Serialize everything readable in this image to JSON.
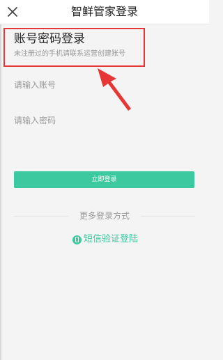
{
  "nav": {
    "title": "智鲜管家登录",
    "close_icon": "close-icon"
  },
  "header": {
    "title": "账号密码登录",
    "subtitle": "未注册过的手机请联系运营创建账号"
  },
  "form": {
    "account_placeholder": "请输入账号",
    "password_placeholder": "请输入密码",
    "login_label": "立即登录"
  },
  "more": {
    "label": "更多登录方式",
    "sms_label": "短信验证登陆",
    "sms_icon": "phone-icon"
  },
  "colors": {
    "accent": "#3cc99f",
    "highlight": "#e63636"
  }
}
